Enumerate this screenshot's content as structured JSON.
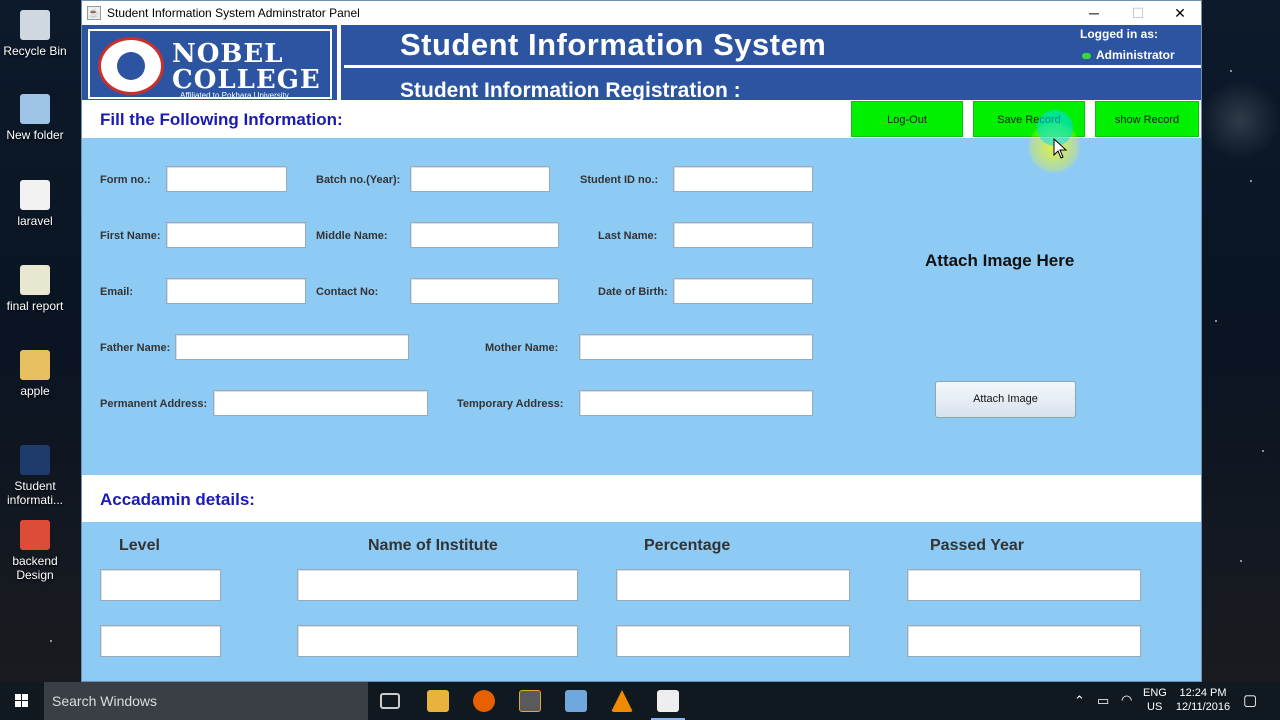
{
  "desktop": {
    "icons": [
      {
        "label": "Recycle Bin",
        "icon": "recycle-bin-icon",
        "color": "#cfd8e0"
      },
      {
        "label": "New folder",
        "icon": "folder-icon",
        "color": "#9ec4e8"
      },
      {
        "label": "laravel",
        "icon": "file-icon",
        "color": "#f2f2f2"
      },
      {
        "label": "final report",
        "icon": "report-file-icon",
        "color": "#e8e8d0"
      },
      {
        "label": "apple",
        "icon": "folder-icon",
        "color": "#e8c062"
      },
      {
        "label": "Student informati...",
        "icon": "app-shortcut-icon",
        "color": "#1f3b6b"
      },
      {
        "label": "backend Design",
        "icon": "chrome-icon",
        "color": "#dd4b39"
      }
    ]
  },
  "window": {
    "title": "Student Information System Adminstrator Panel",
    "minimize": "─",
    "maximize": "☐",
    "close": "✕"
  },
  "header": {
    "logo_line1": "NOBEL",
    "logo_line2": "COLLEGE",
    "logo_sub": "Affiliated to Pokhara University",
    "title": "Student Information System",
    "subtitle": "Student Information Registration :",
    "logged_label": "Logged in as:",
    "logged_user": "Administrator"
  },
  "form": {
    "section_title": "Fill the Following Information:",
    "buttons": {
      "logout": "Log-Out",
      "save": "Save Record",
      "show": "show Record"
    },
    "labels": {
      "form_no": "Form no.:",
      "batch_no": "Batch no.(Year):",
      "student_id": "Student ID no.:",
      "first_name": "First Name:",
      "middle_name": "Middle Name:",
      "last_name": "Last Name:",
      "email": "Email:",
      "contact": "Contact No:",
      "dob": "Date of Birth:",
      "father": "Father Name:",
      "mother": "Mother Name:",
      "permanent": "Permanent Address:",
      "temporary": "Temporary Address:"
    },
    "values": {
      "form_no": "",
      "batch_no": "",
      "student_id": "",
      "first_name": "",
      "middle_name": "",
      "last_name": "",
      "email": "",
      "contact": "",
      "dob": "",
      "father": "",
      "mother": "",
      "permanent": "",
      "temporary": ""
    },
    "attach_label": "Attach Image Here",
    "attach_button": "Attach Image"
  },
  "academic": {
    "section_title": "Accadamin details:",
    "columns": [
      "Level",
      "Name of Institute",
      "Percentage",
      "Passed Year"
    ],
    "rows": [
      [
        "",
        "",
        "",
        ""
      ],
      [
        "",
        "",
        "",
        ""
      ]
    ]
  },
  "taskbar": {
    "search_placeholder": "Search Windows",
    "lang_line1": "ENG",
    "lang_line2": "US",
    "time": "12:24 PM",
    "date": "12/11/2016"
  },
  "colors": {
    "header_bg": "#2c54a0",
    "panel_bg": "#8ecbf4",
    "button_green": "#00f000",
    "section_title": "#1a1ab8"
  }
}
